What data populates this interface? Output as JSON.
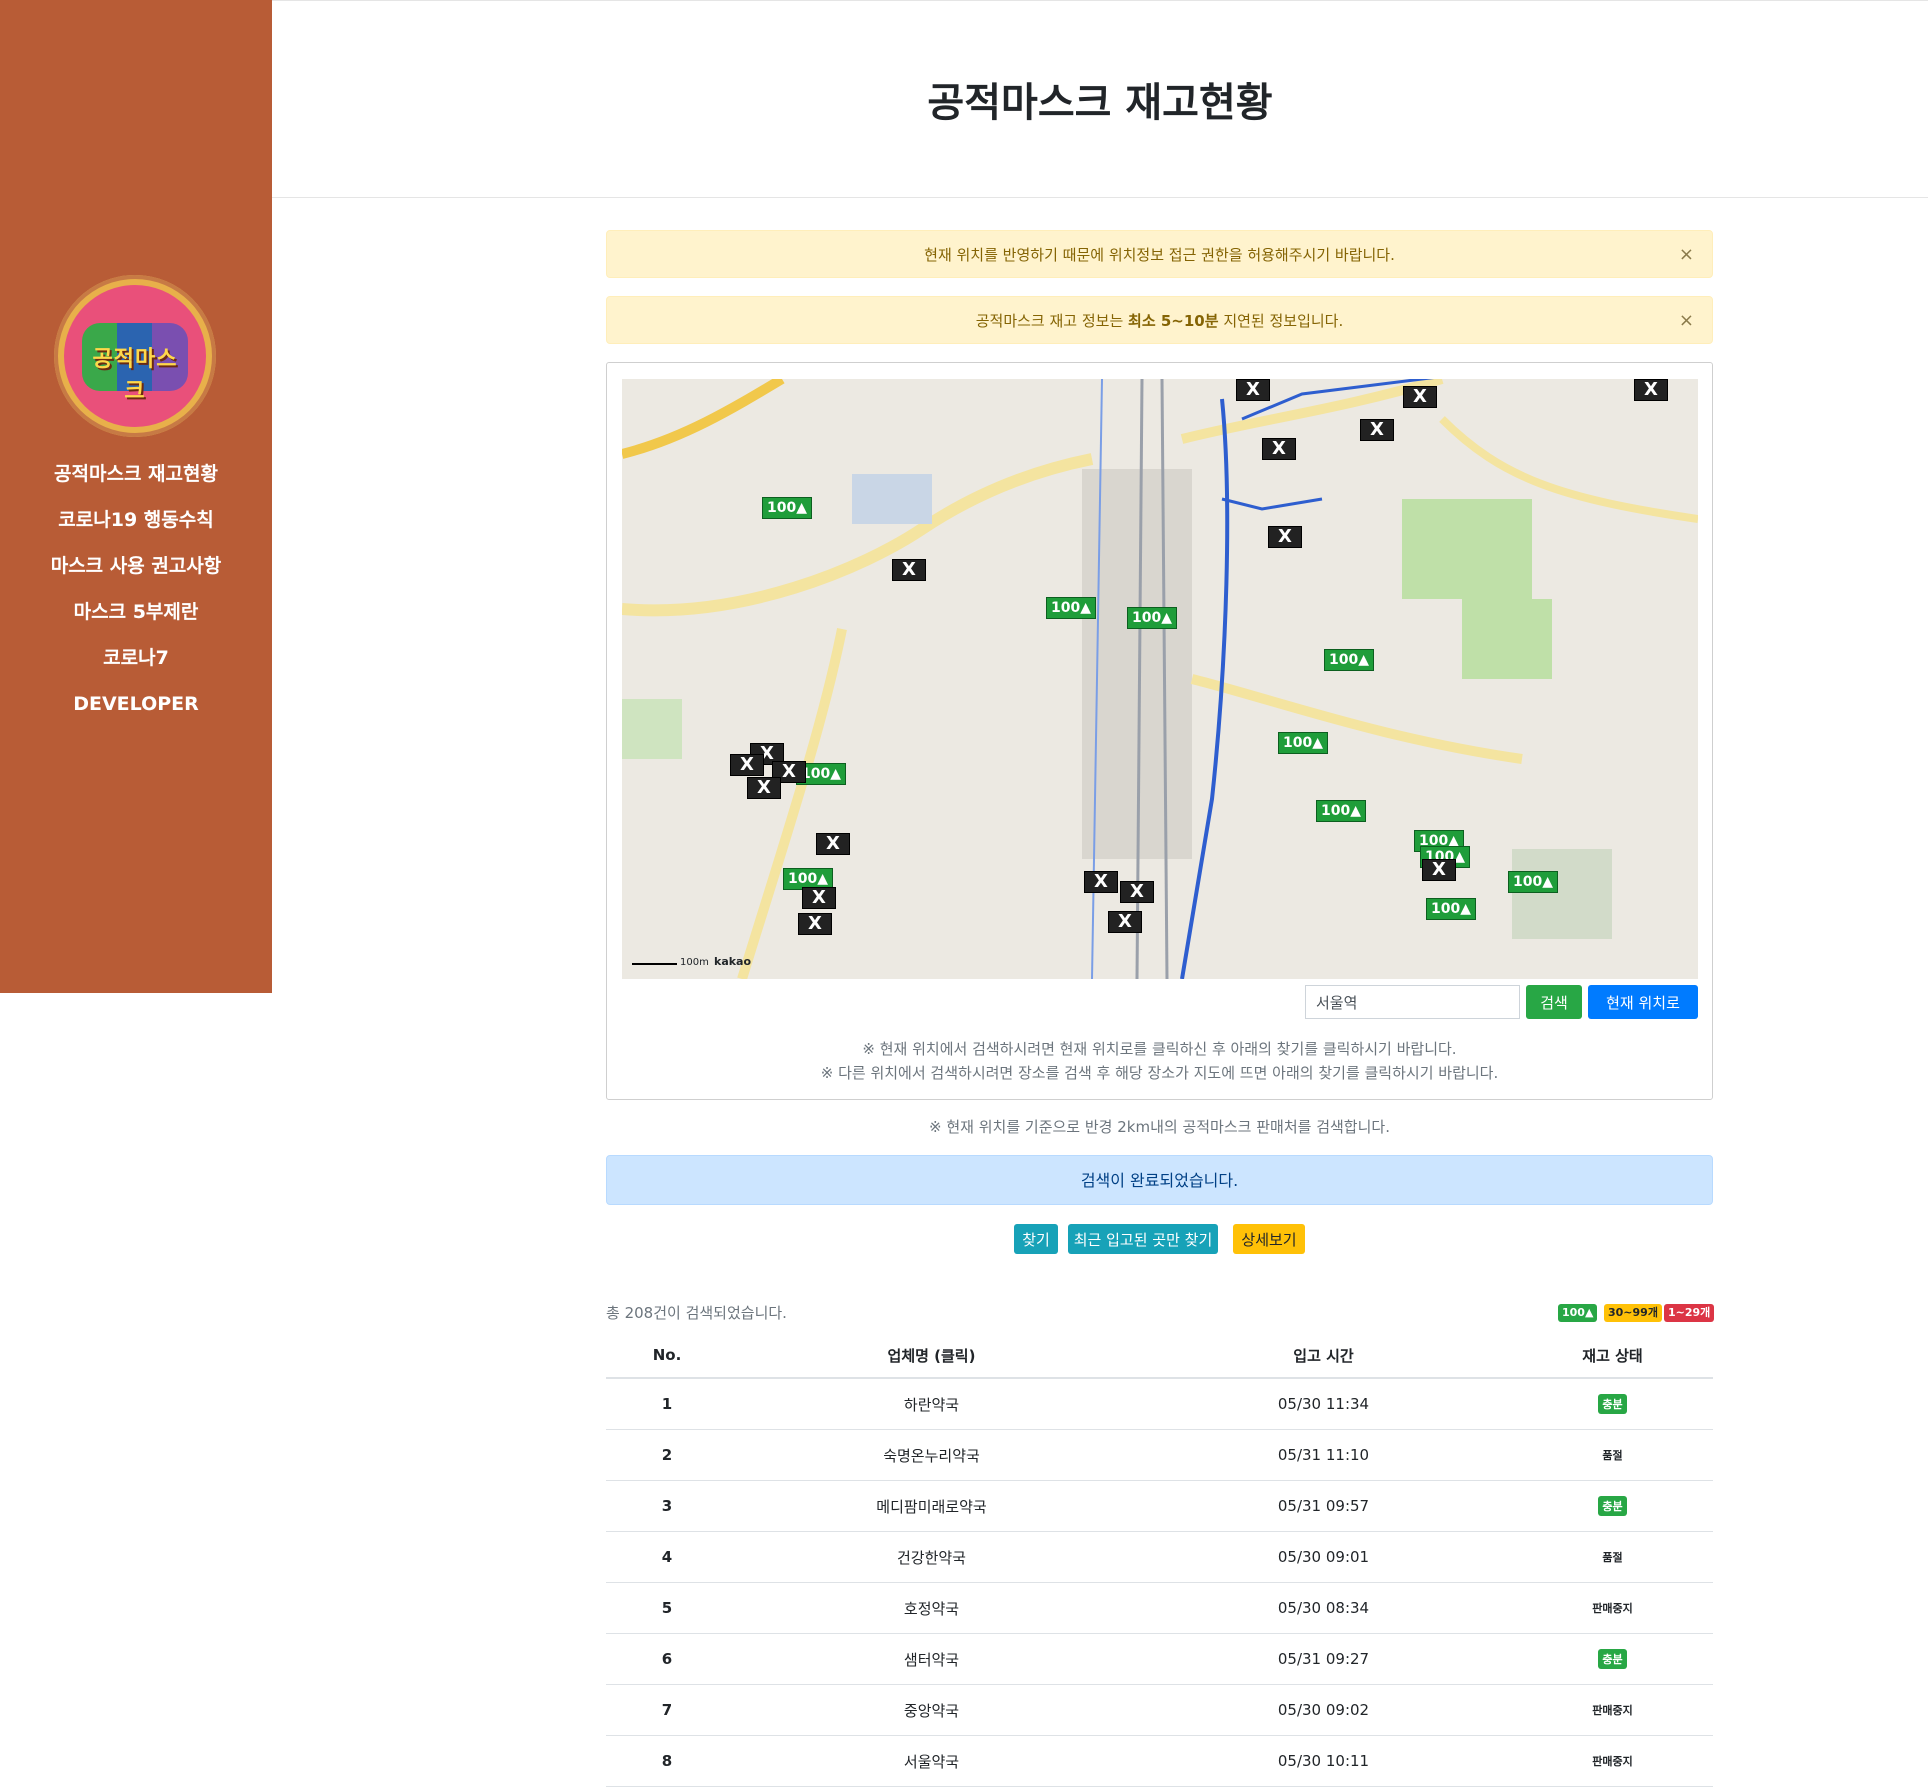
{
  "sidebar": {
    "logo_text": "공적마스크",
    "items": [
      {
        "label": "공적마스크 재고현황"
      },
      {
        "label": "코로나19 행동수칙"
      },
      {
        "label": "마스크 사용 권고사항"
      },
      {
        "label": "마스크 5부제란"
      },
      {
        "label": "코로나7"
      },
      {
        "label": "DEVELOPER"
      }
    ]
  },
  "header": {
    "title": "공적마스크 재고현황"
  },
  "alerts": {
    "location": "현재 위치를 반영하기 때문에 위치정보 접근 권한을 허용해주시기 바랍니다.",
    "delay_prefix": "공적마스크 재고 정보는 ",
    "delay_bold": "최소 5~10분",
    "delay_suffix": " 지연된 정보입니다.",
    "close": "×"
  },
  "map": {
    "scale_label": "100m",
    "provider": "kakao",
    "search_value": "서울역",
    "search_button": "검색",
    "current_location_button": "현재 위치로",
    "green_label": "100▲",
    "x_label": "X"
  },
  "notes": {
    "line1": "※ 현재 위치에서 검색하시려면 현재 위치로를 클릭하신 후 아래의 찾기를 클릭하시기 바랍니다.",
    "line2": "※ 다른 위치에서 검색하시려면 장소를 검색 후 해당 장소가 지도에 뜨면 아래의 찾기를 클릭하시기 바랍니다.",
    "radius": "※ 현재 위치를 기준으로 반경 2km내의 공적마스크 판매처를 검색합니다."
  },
  "search_status": "검색이 완료되었습니다.",
  "actions": {
    "find": "찾기",
    "recent": "최근 입고된 곳만 찾기",
    "detail": "상세보기"
  },
  "results": {
    "count_text": "총 208건이 검색되었습니다.",
    "legend": [
      {
        "label": "100▲",
        "color": "#28a745"
      },
      {
        "label": "30~99개",
        "color": "#ffc107"
      },
      {
        "label": "1~29개",
        "color": "#dc3545"
      }
    ],
    "columns": [
      "No.",
      "업체명 (클릭)",
      "입고 시간",
      "재고 상태"
    ],
    "rows": [
      {
        "no": "1",
        "name": "하란약국",
        "time": "05/30 11:34",
        "status": "충분"
      },
      {
        "no": "2",
        "name": "숙명온누리약국",
        "time": "05/31 11:10",
        "status": "품절"
      },
      {
        "no": "3",
        "name": "메디팜미래로약국",
        "time": "05/31 09:57",
        "status": "충분"
      },
      {
        "no": "4",
        "name": "건강한약국",
        "time": "05/30 09:01",
        "status": "품절"
      },
      {
        "no": "5",
        "name": "호정약국",
        "time": "05/30 08:34",
        "status": "판매중지"
      },
      {
        "no": "6",
        "name": "샘터약국",
        "time": "05/31 09:27",
        "status": "충분"
      },
      {
        "no": "7",
        "name": "중앙약국",
        "time": "05/30 09:02",
        "status": "판매중지"
      },
      {
        "no": "8",
        "name": "서울약국",
        "time": "05/30 10:11",
        "status": "판매중지"
      }
    ]
  },
  "colors": {
    "sidebar": "#b85c36",
    "accent_green": "#28a745",
    "accent_blue": "#007bff",
    "teal": "#17a2b8"
  }
}
